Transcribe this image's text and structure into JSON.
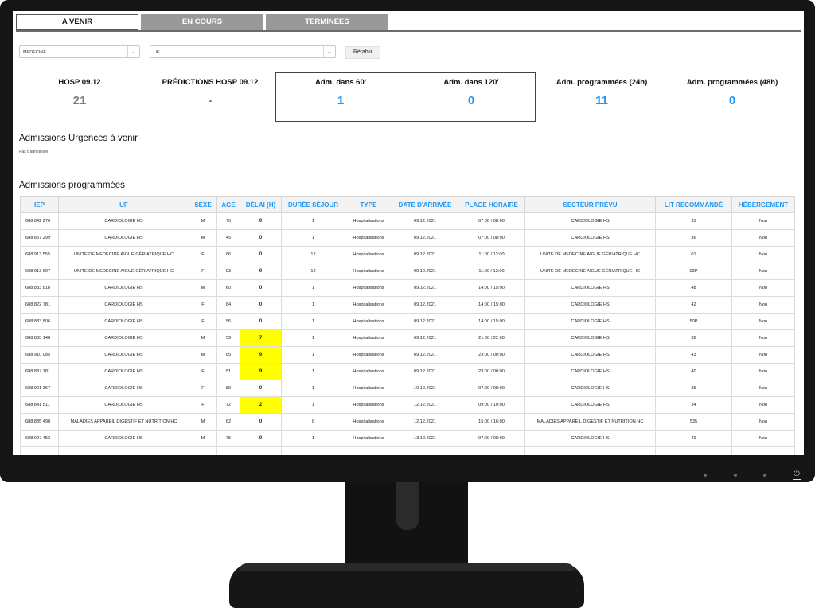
{
  "tabs": [
    {
      "label": "A VENIR",
      "active": true
    },
    {
      "label": "EN COURS",
      "active": false
    },
    {
      "label": "TERMINÉES",
      "active": false
    }
  ],
  "filters": {
    "service": "MEDECINE",
    "uf": "UF",
    "reset_label": "Rétablir"
  },
  "kpis": [
    {
      "label": "HOSP 09.12",
      "value": "21",
      "color": "gray"
    },
    {
      "label": "PRÉDICTIONS HOSP 09.12",
      "value": "-",
      "color": "blue"
    },
    {
      "label": "Adm. dans 60'",
      "value": "1",
      "color": "blue"
    },
    {
      "label": "Adm. dans 120'",
      "value": "0",
      "color": "blue"
    },
    {
      "label": "Adm. programmées (24h)",
      "value": "11",
      "color": "blue"
    },
    {
      "label": "Adm. programmées (48h)",
      "value": "0",
      "color": "blue"
    }
  ],
  "urgences": {
    "title": "Admissions Urgences à venir",
    "empty_text": "Pas d'admission"
  },
  "programmees": {
    "title": "Admissions programmées",
    "columns": [
      "IEP",
      "UF",
      "SEXE",
      "AGE",
      "DÉLAI (H)",
      "DURÉE SÉJOUR",
      "TYPE",
      "DATE D'ARRIVÉE",
      "PLAGE HORAIRE",
      "SECTEUR PRÉVU",
      "LIT RECOMMANDÉ",
      "HÉBERGEMENT"
    ],
    "highlight_color": "#ffff00",
    "rows": [
      {
        "iep": "688 842 276",
        "uf": "CARDIOLOGIE HS",
        "sexe": "M",
        "age": "75",
        "delai": "0",
        "hl": false,
        "duree": "1",
        "type": "Hospitalisations",
        "date": "09.12.2021",
        "plage": "07:00 / 08:00",
        "secteur": "CARDIOLOGIE HS",
        "lit": "33",
        "heb": "Non"
      },
      {
        "iep": "688 867 299",
        "uf": "CARDIOLOGIE HS",
        "sexe": "M",
        "age": "45",
        "delai": "0",
        "hl": false,
        "duree": "1",
        "type": "Hospitalisations",
        "date": "09.12.2021",
        "plage": "07:00 / 08:00",
        "secteur": "CARDIOLOGIE HS",
        "lit": "36",
        "heb": "Non"
      },
      {
        "iep": "688 913 555",
        "uf": "UNITE DE MEDECINE AIGUE GÉRIATRIQUE HC",
        "sexe": "F",
        "age": "86",
        "delai": "0",
        "hl": false,
        "duree": "12",
        "type": "Hospitalisations",
        "date": "09.12.2021",
        "plage": "11:00 / 12:00",
        "secteur": "UNITE DE MEDECINE AIGUE GÉRIATRIQUE HC",
        "lit": "01",
        "heb": "Non"
      },
      {
        "iep": "688 913 607",
        "uf": "UNITE DE MEDECINE AIGUE GÉRIATRIQUE HC",
        "sexe": "F",
        "age": "93",
        "delai": "0",
        "hl": false,
        "duree": "12",
        "type": "Hospitalisations",
        "date": "09.12.2021",
        "plage": "11:00 / 12:00",
        "secteur": "UNITE DE MEDECINE AIGUE GÉRIATRIQUE HC",
        "lit": "03P",
        "heb": "Non"
      },
      {
        "iep": "688 883 818",
        "uf": "CARDIOLOGIE HS",
        "sexe": "M",
        "age": "60",
        "delai": "0",
        "hl": false,
        "duree": "1",
        "type": "Hospitalisations",
        "date": "09.12.2021",
        "plage": "14:00 / 15:00",
        "secteur": "CARDIOLOGIE HS",
        "lit": "48",
        "heb": "Non"
      },
      {
        "iep": "688 822 781",
        "uf": "CARDIOLOGIE HS",
        "sexe": "F",
        "age": "84",
        "delai": "0",
        "hl": false,
        "duree": "1",
        "type": "Hospitalisations",
        "date": "09.12.2021",
        "plage": "14:00 / 15:00",
        "secteur": "CARDIOLOGIE HS",
        "lit": "42",
        "heb": "Non"
      },
      {
        "iep": "688 883 806",
        "uf": "CARDIOLOGIE HS",
        "sexe": "F",
        "age": "56",
        "delai": "0",
        "hl": false,
        "duree": "1",
        "type": "Hospitalisations",
        "date": "09.12.2021",
        "plage": "14:00 / 15:00",
        "secteur": "CARDIOLOGIE HS",
        "lit": "50P",
        "heb": "Non"
      },
      {
        "iep": "688 835 148",
        "uf": "CARDIOLOGIE HS",
        "sexe": "M",
        "age": "59",
        "delai": "7",
        "hl": true,
        "duree": "1",
        "type": "Hospitalisations",
        "date": "09.12.2021",
        "plage": "21:00 / 22:00",
        "secteur": "CARDIOLOGIE HS",
        "lit": "38",
        "heb": "Non"
      },
      {
        "iep": "688 910 085",
        "uf": "CARDIOLOGIE HS",
        "sexe": "M",
        "age": "65",
        "delai": "9",
        "hl": true,
        "duree": "1",
        "type": "Hospitalisations",
        "date": "09.12.2021",
        "plage": "23:00 / 00:00",
        "secteur": "CARDIOLOGIE HS",
        "lit": "43",
        "heb": "Non"
      },
      {
        "iep": "688 887 181",
        "uf": "CARDIOLOGIE HS",
        "sexe": "F",
        "age": "51",
        "delai": "9",
        "hl": true,
        "duree": "1",
        "type": "Hospitalisations",
        "date": "09.12.2021",
        "plage": "23:00 / 00:00",
        "secteur": "CARDIOLOGIE HS",
        "lit": "40",
        "heb": "Non"
      },
      {
        "iep": "688 901 367",
        "uf": "CARDIOLOGIE HS",
        "sexe": "F",
        "age": "89",
        "delai": "0",
        "hl": false,
        "duree": "1",
        "type": "Hospitalisations",
        "date": "10.12.2021",
        "plage": "07:00 / 08:00",
        "secteur": "CARDIOLOGIE HS",
        "lit": "35",
        "heb": "Non"
      },
      {
        "iep": "688 841 511",
        "uf": "CARDIOLOGIE HS",
        "sexe": "F",
        "age": "72",
        "delai": "2",
        "hl": true,
        "duree": "1",
        "type": "Hospitalisations",
        "date": "12.12.2021",
        "plage": "09:00 / 10:00",
        "secteur": "CARDIOLOGIE HS",
        "lit": "34",
        "heb": "Non"
      },
      {
        "iep": "688 885 498",
        "uf": "MALADIES APPAREIL DIGESTIF ET NUTRITION HC",
        "sexe": "M",
        "age": "62",
        "delai": "0",
        "hl": false,
        "duree": "8",
        "type": "Hospitalisations",
        "date": "12.12.2021",
        "plage": "15:00 / 16:00",
        "secteur": "MALADIES APPAREIL DIGESTIF ET NUTRITION HC",
        "lit": "535",
        "heb": "Non"
      },
      {
        "iep": "688 907 452",
        "uf": "CARDIOLOGIE HS",
        "sexe": "M",
        "age": "75",
        "delai": "0",
        "hl": false,
        "duree": "1",
        "type": "Hospitalisations",
        "date": "13.12.2021",
        "plage": "07:00 / 08:00",
        "secteur": "CARDIOLOGIE HS",
        "lit": "49",
        "heb": "Non"
      },
      {
        "iep": "",
        "uf": "",
        "sexe": "",
        "age": "",
        "delai": "",
        "hl": false,
        "duree": "",
        "type": "",
        "date": "",
        "plage": "",
        "secteur": "",
        "lit": "",
        "heb": ""
      }
    ]
  }
}
